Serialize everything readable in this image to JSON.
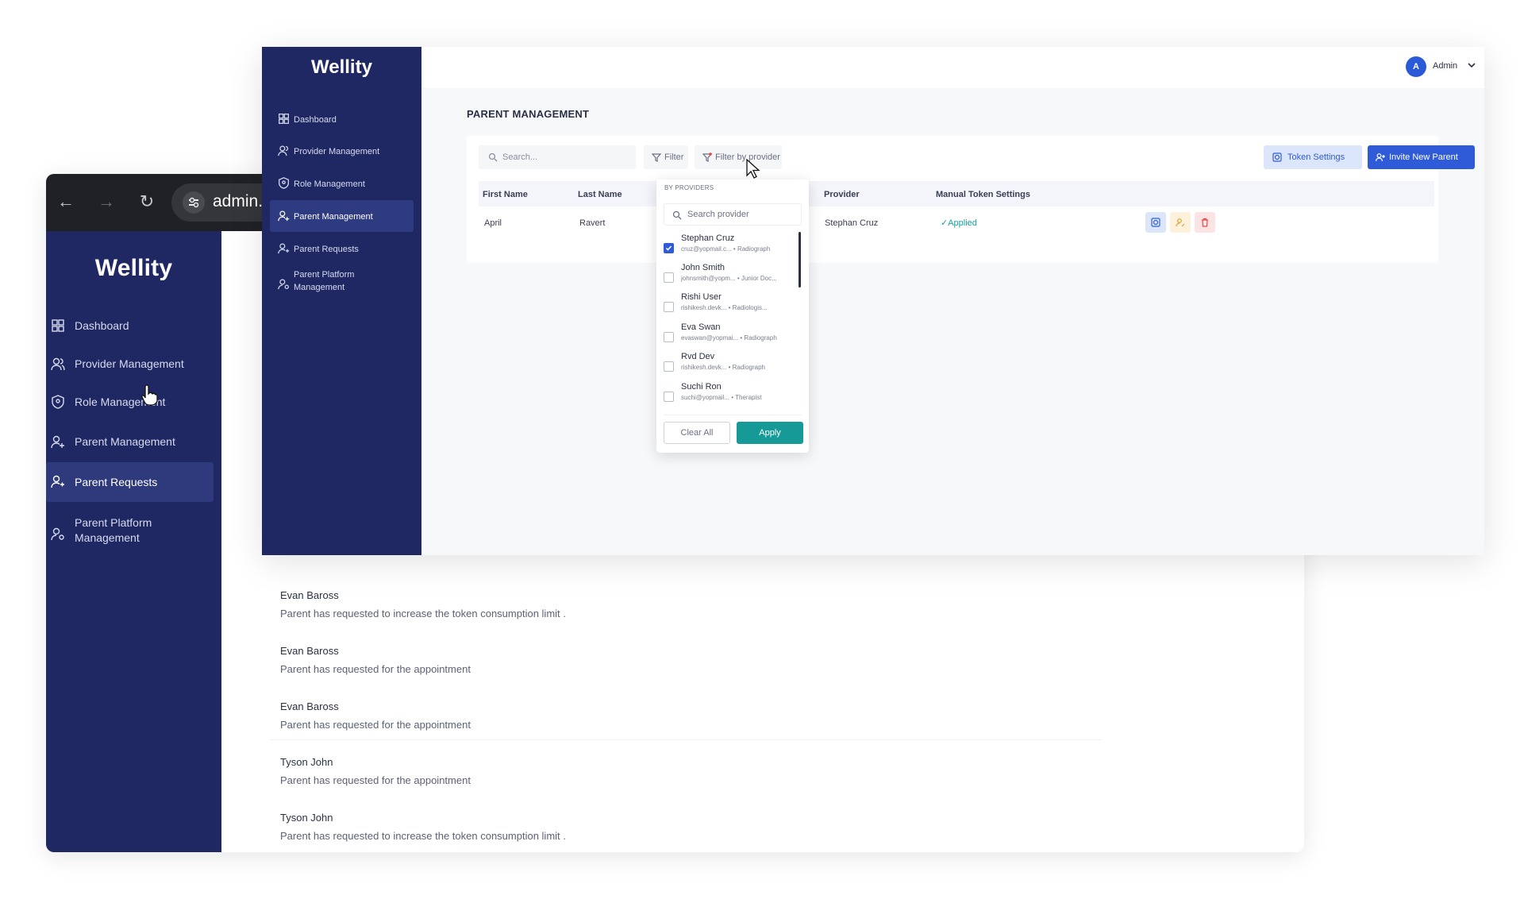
{
  "back": {
    "url_text": "admin.c",
    "logo": "Wellity",
    "sidebar": [
      {
        "label": "Dashboard",
        "icon": "dashboard-icon"
      },
      {
        "label": "Provider Management",
        "icon": "provider-icon"
      },
      {
        "label": "Role Management",
        "icon": "shield-icon"
      },
      {
        "label": "Parent Management",
        "icon": "parent-icon"
      },
      {
        "label": "Parent Requests",
        "icon": "user-icon",
        "active": true
      },
      {
        "label": "Parent Platform",
        "label2": "Management",
        "icon": "user-gear-icon"
      }
    ],
    "requests": [
      {
        "name": "Evan Baross",
        "desc": "Parent has requested to increase the token consumption limit ."
      },
      {
        "name": "Evan Baross",
        "desc": "Parent has requested for the appointment"
      },
      {
        "name": "Evan Baross",
        "desc": "Parent has requested for the appointment"
      },
      {
        "name": "Tyson John",
        "desc": "Parent has requested for the appointment"
      },
      {
        "name": "Tyson John",
        "desc": "Parent has requested to increase the token consumption limit ."
      }
    ]
  },
  "front": {
    "logo": "Wellity",
    "sidebar": [
      {
        "label": "Dashboard",
        "icon": "dashboard-icon"
      },
      {
        "label": "Provider Management",
        "icon": "provider-icon"
      },
      {
        "label": "Role Management",
        "icon": "shield-icon"
      },
      {
        "label": "Parent Management",
        "icon": "parent-icon",
        "active": true
      },
      {
        "label": "Parent Requests",
        "icon": "user-icon"
      },
      {
        "label": "Parent Platform",
        "label2": "Management",
        "icon": "user-gear-icon"
      }
    ],
    "topbar": {
      "avatar_initial": "A",
      "user_label": "Admin"
    },
    "page_title": "PARENT MANAGEMENT",
    "search_placeholder": "Search...",
    "filter_label": "Filter",
    "filter_provider_label": "Filter by provider",
    "token_settings_label": "Token Settings",
    "invite_label": "Invite New Parent",
    "table": {
      "headers": [
        "First Name",
        "Last Name",
        "Provider",
        "Manual Token Settings"
      ],
      "rows": [
        {
          "first_name": "April",
          "last_name": "Ravert",
          "provider": "Stephan Cruz",
          "manual_token": "Applied"
        }
      ]
    },
    "dropdown": {
      "title": "BY PROVIDERS",
      "search_placeholder": "Search provider",
      "providers": [
        {
          "name": "Stephan Cruz",
          "email": "cruz@yopmail.c...",
          "role": "Radiograph",
          "checked": true
        },
        {
          "name": "John Smith",
          "email": "johnsmith@yopm...",
          "role": "Junior Doc...",
          "checked": false
        },
        {
          "name": "Rishi User",
          "email": "rishikesh.devk...",
          "role": "Radiologis...",
          "checked": false
        },
        {
          "name": "Eva Swan",
          "email": "evaswan@yopmai...",
          "role": "Radiograph",
          "checked": false
        },
        {
          "name": "Rvd Dev",
          "email": "rishikesh.devk...",
          "role": "Radiograph",
          "checked": false
        },
        {
          "name": "Suchi Ron",
          "email": "suchi@yopmail...",
          "role": "Therapist",
          "checked": false
        }
      ],
      "clear_label": "Clear All",
      "apply_label": "Apply"
    }
  },
  "colors": {
    "sidebar": "#1f2863",
    "primary": "#2f5bd9",
    "apply": "#159a98"
  }
}
